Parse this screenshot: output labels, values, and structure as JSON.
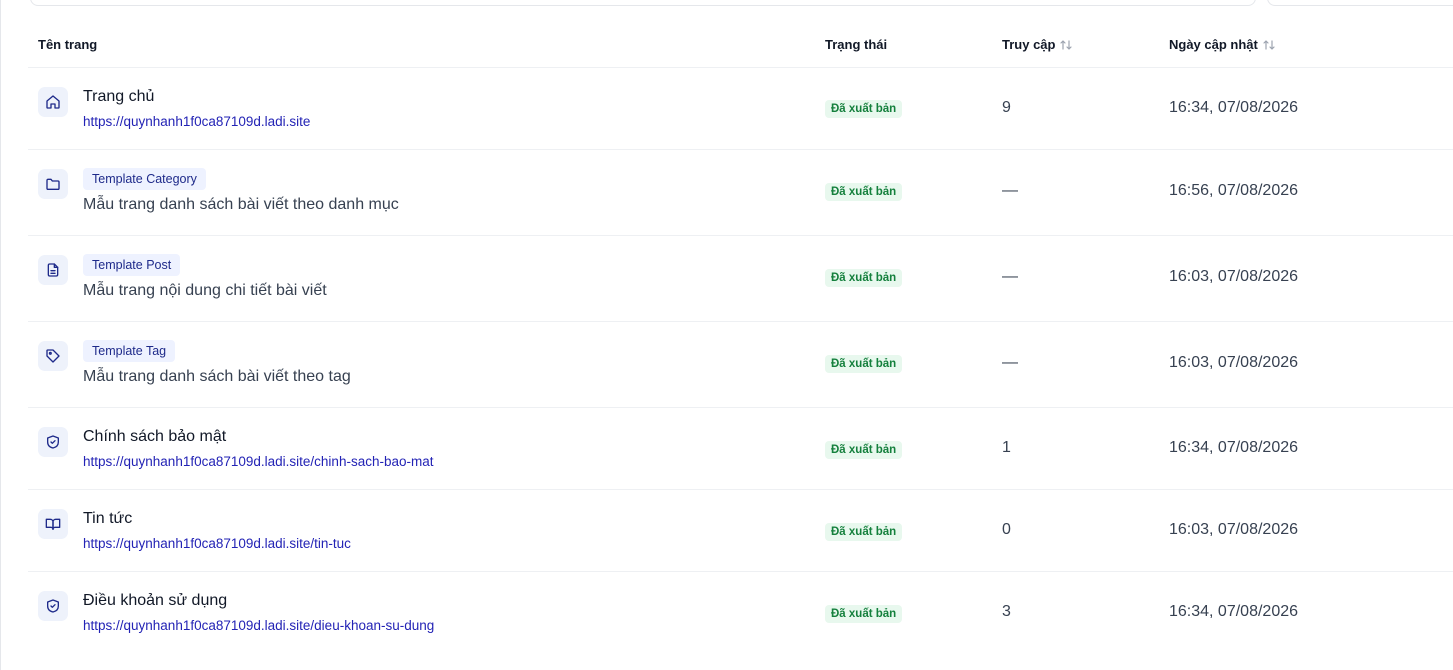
{
  "table": {
    "headers": {
      "name": "Tên trang",
      "status": "Trạng thái",
      "visits": "Truy cập",
      "updated": "Ngày cập nhật"
    },
    "rows": [
      {
        "icon": "home-icon",
        "title": "Trang chủ",
        "url": "https://quynhanh1f0ca87109d.ladi.site",
        "status": "Đã xuất bản",
        "visits": "9",
        "updated": "16:34, 07/08/2026"
      },
      {
        "icon": "folder-icon",
        "badge": "Template Category",
        "description": "Mẫu trang danh sách bài viết theo danh mục",
        "status": "Đã xuất bản",
        "visits": "—",
        "updated": "16:56, 07/08/2026"
      },
      {
        "icon": "document-icon",
        "badge": "Template Post",
        "description": "Mẫu trang nội dung chi tiết bài viết",
        "status": "Đã xuất bản",
        "visits": "—",
        "updated": "16:03, 07/08/2026"
      },
      {
        "icon": "tag-icon",
        "badge": "Template Tag",
        "description": "Mẫu trang danh sách bài viết theo tag",
        "status": "Đã xuất bản",
        "visits": "—",
        "updated": "16:03, 07/08/2026"
      },
      {
        "icon": "shield-check-icon",
        "title": "Chính sách bảo mật",
        "url": "https://quynhanh1f0ca87109d.ladi.site/chinh-sach-bao-mat",
        "status": "Đã xuất bản",
        "visits": "1",
        "updated": "16:34, 07/08/2026"
      },
      {
        "icon": "book-open-icon",
        "title": "Tin tức",
        "url": "https://quynhanh1f0ca87109d.ladi.site/tin-tuc",
        "status": "Đã xuất bản",
        "visits": "0",
        "updated": "16:03, 07/08/2026"
      },
      {
        "icon": "shield-check-icon",
        "title": "Điều khoản sử dụng",
        "url": "https://quynhanh1f0ca87109d.ladi.site/dieu-khoan-su-dung",
        "status": "Đã xuất bản",
        "visits": "3",
        "updated": "16:34, 07/08/2026"
      }
    ]
  },
  "colors": {
    "link": "#2323b5",
    "status_bg": "#e8f8ee",
    "status_text": "#15803d",
    "icon_bg": "#eef2fb",
    "icon_stroke": "#1e2a8a",
    "badge_bg": "#eef2ff",
    "badge_text": "#1e2a8a"
  }
}
